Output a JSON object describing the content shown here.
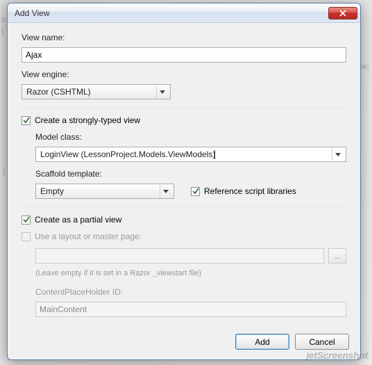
{
  "dialog": {
    "title": "Add View",
    "close_icon": "close"
  },
  "fields": {
    "view_name_label": "View name:",
    "view_name_value": "Ajax",
    "view_engine_label": "View engine:",
    "view_engine_value": "Razor (CSHTML)"
  },
  "strongly_typed": {
    "checkbox_label": "Create a strongly-typed view",
    "checked": true,
    "model_class_label": "Model class:",
    "model_class_value": "LoginView (LessonProject.Models.ViewModels)",
    "scaffold_label": "Scaffold template:",
    "scaffold_value": "Empty",
    "ref_scripts_label": "Reference script libraries",
    "ref_scripts_checked": true
  },
  "partial": {
    "label": "Create as a partial view",
    "checked": true
  },
  "layout": {
    "label": "Use a layout or master page:",
    "checked": false,
    "disabled": true,
    "path_value": "",
    "browse_label": "...",
    "hint": "(Leave empty if it is set in a Razor _viewstart file)",
    "cph_label": "ContentPlaceHolder ID:",
    "cph_value": "MainContent"
  },
  "buttons": {
    "add": "Add",
    "cancel": "Cancel"
  },
  "watermark": "jetScreenshot"
}
